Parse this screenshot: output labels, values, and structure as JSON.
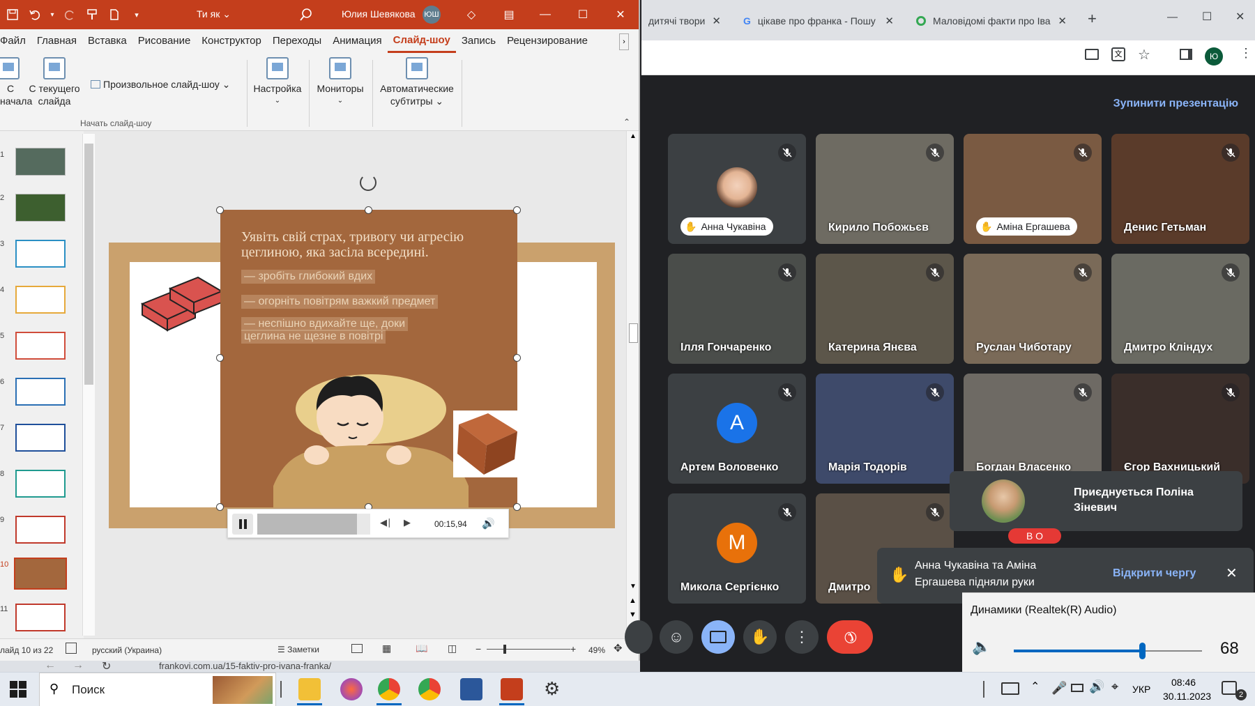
{
  "powerpoint": {
    "file_name": "Ти як",
    "user_name": "Юлия Шевякова",
    "user_initials": "ЮШ",
    "tabs": [
      "Файл",
      "Главная",
      "Вставка",
      "Рисование",
      "Конструктор",
      "Переходы",
      "Анимация",
      "Слайд-шоу",
      "Запись",
      "Рецензирование"
    ],
    "active_tab": "Слайд-шоу",
    "ribbon": {
      "from_start_1": "С",
      "from_start_2": "начала",
      "from_current_1": "С текущего",
      "from_current_2": "слайда",
      "custom_show": "Произвольное слайд-шоу",
      "group_label": "Начать слайд-шоу",
      "setup": "Настройка",
      "monitors": "Мониторы",
      "subtitles_1": "Автоматические",
      "subtitles_2": "субтитры"
    },
    "slide_numbers": [
      "1",
      "2",
      "3",
      "4",
      "5",
      "6",
      "7",
      "8",
      "9",
      "10",
      "11"
    ],
    "slide": {
      "title": "Уявіть свій страх, тривогу чи агресію цеглиною, яка засіла всередині.",
      "bullet_1": "— зробіть глибокий вдих",
      "bullet_2": "— огорніть повітрям важкий предмет",
      "bullet_3a": "— неспішно вдихайте ще, доки",
      "bullet_3b": "цеглина не щезне в повітрі"
    },
    "media_time": "00:15,94",
    "media_progress": 0.88,
    "status": {
      "slide_counter": "лайд 10 из 22",
      "language": "русский (Украина)",
      "notes": "Заметки",
      "zoom": "49%"
    }
  },
  "chrome": {
    "tabs": [
      {
        "title": "дитячі твори"
      },
      {
        "title": "цікаве про франка - Пошу"
      },
      {
        "title": "Маловідомі факти про Іва"
      }
    ],
    "profile_initial": "Ю",
    "address_bottom": "frankovi.com.ua/15-faktiv-pro-ivana-franka/"
  },
  "meet": {
    "stop_presentation": "Зупинити презентацію",
    "participants": [
      {
        "name": "Анна Чукавіна",
        "hand": true
      },
      {
        "name": "Кирило Побожьєв",
        "hand": false
      },
      {
        "name": "Аміна Ергашева",
        "hand": true
      },
      {
        "name": "Денис Гетьман",
        "hand": false
      },
      {
        "name": "Ілля Гончаренко",
        "hand": false
      },
      {
        "name": "Катерина Янєва",
        "hand": false
      },
      {
        "name": "Руслан Чиботару",
        "hand": false
      },
      {
        "name": "Дмитро Кліндух",
        "hand": false
      },
      {
        "name": "Артем Воловенко",
        "hand": false,
        "initial": "А"
      },
      {
        "name": "Марія Тодорів",
        "hand": false
      },
      {
        "name": "Богдан Власенко",
        "hand": false
      },
      {
        "name": "Єгор Вахницький",
        "hand": false
      },
      {
        "name": "Микола Сергієнко",
        "hand": false,
        "initial": "М"
      },
      {
        "name": "Дмитро",
        "hand": false
      }
    ],
    "joining_notification": "Приєднується Поліна Зіневич",
    "hands_notification": "Анна Чукавіна та Аміна Ергашева підняли руки",
    "open_queue": "Відкрити чергу",
    "badge_letters": "В О"
  },
  "volume": {
    "device": "Динамики (Realtek(R) Audio)",
    "level": 68,
    "level_text": "68"
  },
  "taskbar": {
    "search": "Поиск",
    "language": "УКР",
    "time": "08:46",
    "date": "30.11.2023",
    "notifications": "2"
  },
  "colors": {
    "ppt_accent": "#c43e1c",
    "meet_link": "#8ab4f8",
    "end_call": "#ea4335"
  }
}
